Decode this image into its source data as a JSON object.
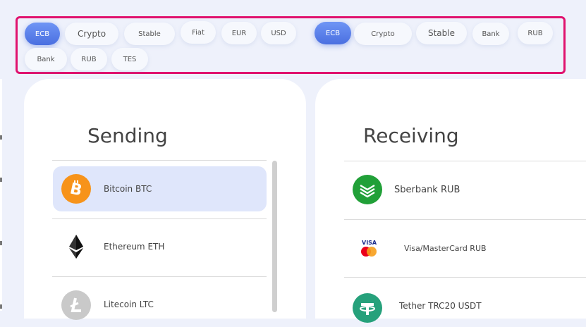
{
  "filters": {
    "left": [
      "ECB",
      "Crypto",
      "Stable",
      "Fiat",
      "EUR",
      "USD"
    ],
    "right": [
      "ECB",
      "Crypto",
      "Stable",
      "Bank",
      "RUB"
    ],
    "row2": [
      "Bank",
      "RUB",
      "TES"
    ]
  },
  "sending": {
    "title": "Sending",
    "items": [
      {
        "label": "Bitcoin BTC",
        "icon": "bitcoin-icon"
      },
      {
        "label": "Ethereum ETH",
        "icon": "ethereum-icon"
      },
      {
        "label": "Litecoin LTC",
        "icon": "litecoin-icon"
      }
    ]
  },
  "receiving": {
    "title": "Receiving",
    "items": [
      {
        "label": "Sberbank RUB",
        "icon": "sberbank-icon"
      },
      {
        "label": "Visa/MasterCard RUB",
        "icon": "visa-mastercard-icon"
      },
      {
        "label": "Tether TRC20 USDT",
        "icon": "tether-icon"
      }
    ]
  },
  "visa_logo_text": "VISA",
  "colors": {
    "accent": "#4a6fe0",
    "highlight_border": "#e0126e",
    "selected_row": "#dfe6fb",
    "bitcoin": "#f7931a",
    "sberbank": "#21a038",
    "tether": "#26a17b"
  }
}
